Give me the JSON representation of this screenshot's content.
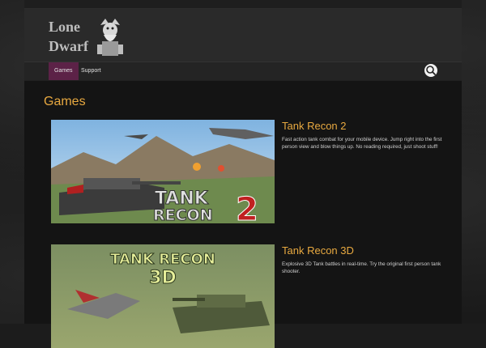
{
  "header": {
    "logo_text_line1": "Lone",
    "logo_text_line2": "Dwarf"
  },
  "nav": {
    "items": [
      {
        "label": "Games",
        "active": true
      },
      {
        "label": "Support",
        "active": false
      }
    ],
    "search_icon": "search-icon"
  },
  "main": {
    "title": "Games",
    "games": [
      {
        "title": "Tank Recon 2",
        "description": "Fast action tank combat for your mobile device. Jump right into the first person view and blow things up. No reading required, just shoot stuff!",
        "thumb_text_line1": "TANK",
        "thumb_text_line2": "RECON",
        "thumb_text_num": "2"
      },
      {
        "title": "Tank Recon 3D",
        "description": "Explosive 3D Tank battles in real-time. Try the original first person tank shooter.",
        "thumb_text_line1": "TANK RECON",
        "thumb_text_line2": "3D"
      }
    ]
  },
  "colors": {
    "accent": "#e8a940",
    "nav_active": "#5c2247"
  }
}
